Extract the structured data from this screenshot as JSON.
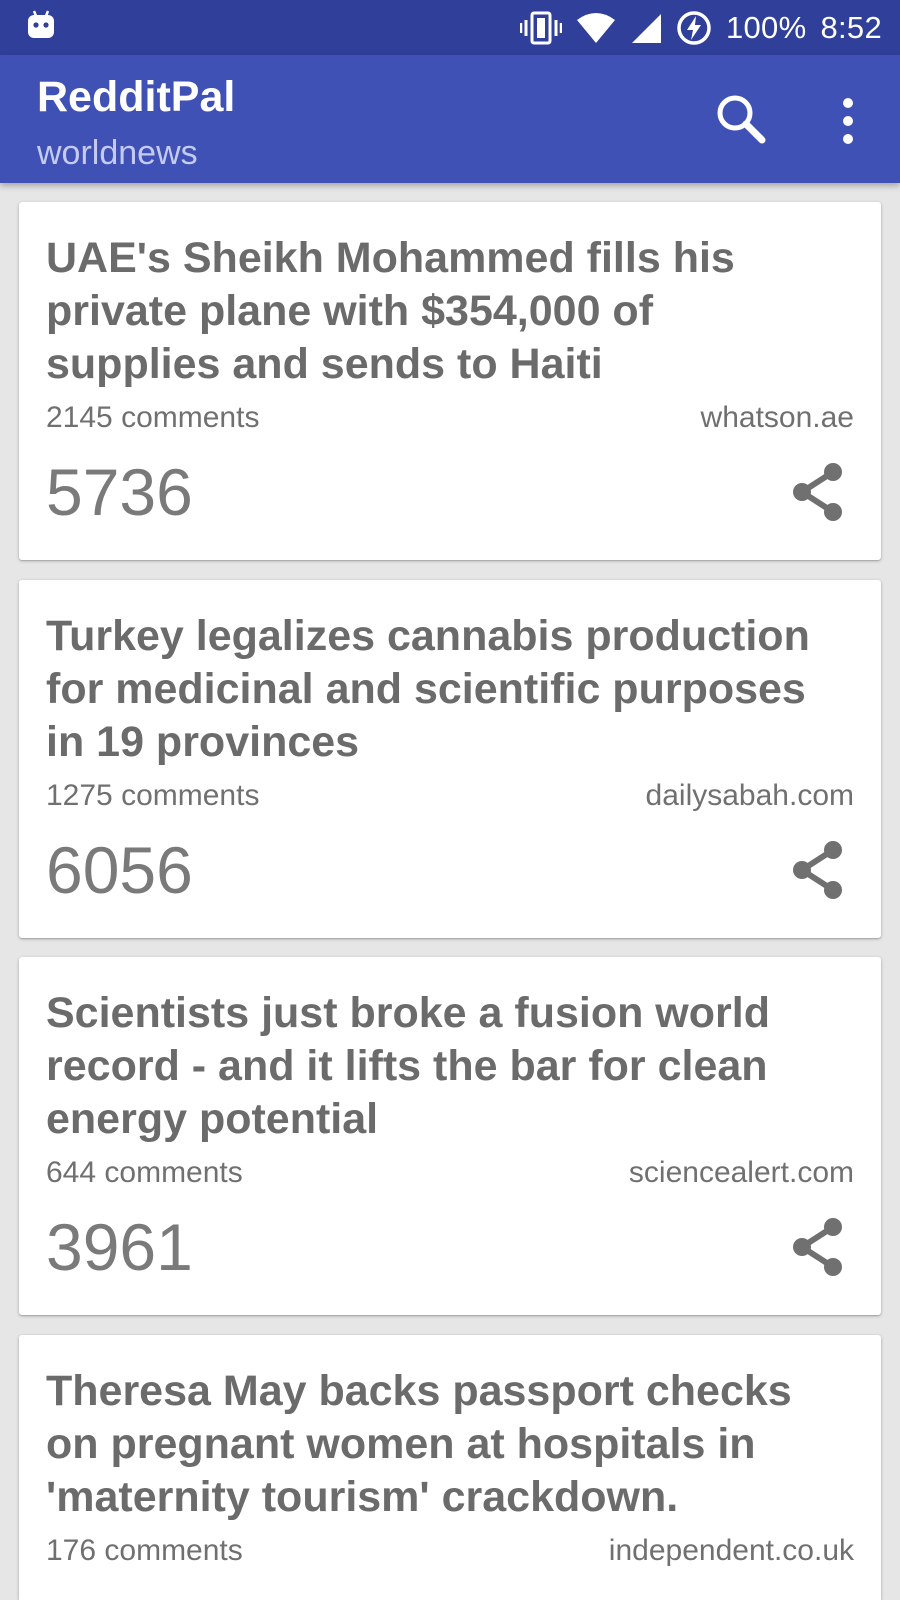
{
  "status_bar": {
    "battery": "100%",
    "time": "8:52",
    "icons": [
      "android-icon",
      "vibrate-icon",
      "wifi-icon",
      "signal-icon",
      "battery-charging-icon"
    ]
  },
  "app_bar": {
    "title": "RedditPal",
    "subtitle": "worldnews",
    "actions": [
      "search-icon",
      "more-vert-icon"
    ],
    "color": "#3f51b5"
  },
  "posts": [
    {
      "title": "UAE's Sheikh Mohammed fills his private plane with $354,000 of supplies and sends to Haiti",
      "comments": "2145 comments",
      "domain": "whatson.ae",
      "score": "5736"
    },
    {
      "title": "Turkey legalizes cannabis production for medicinal and scientific purposes in 19 provinces",
      "comments": "1275 comments",
      "domain": "dailysabah.com",
      "score": "6056"
    },
    {
      "title": "Scientists just broke a fusion world record - and it lifts the bar for clean energy potential",
      "comments": "644 comments",
      "domain": "sciencealert.com",
      "score": "3961"
    },
    {
      "title": "Theresa May backs passport checks on pregnant women at hospitals in 'maternity tourism' crackdown.",
      "comments": "176 comments",
      "domain": "independent.co.uk",
      "score": ""
    }
  ]
}
